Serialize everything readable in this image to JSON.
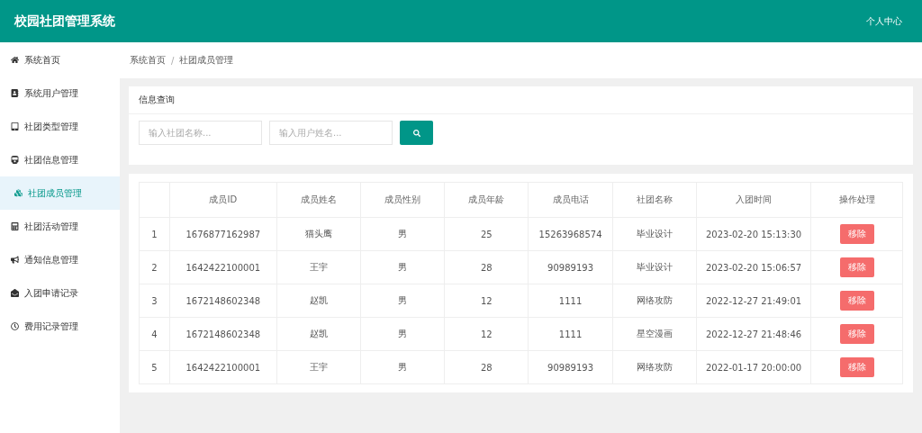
{
  "header": {
    "title": "校园社团管理系统",
    "user_link": "个人中心"
  },
  "sidebar": {
    "items": [
      {
        "label": "系统首页",
        "selected": false
      },
      {
        "label": "系统用户管理",
        "selected": false
      },
      {
        "label": "社团类型管理",
        "selected": false
      },
      {
        "label": "社团信息管理",
        "selected": false
      },
      {
        "label": "社团成员管理",
        "selected": true
      },
      {
        "label": "社团活动管理",
        "selected": false
      },
      {
        "label": "通知信息管理",
        "selected": false
      },
      {
        "label": "入团申请记录",
        "selected": false
      },
      {
        "label": "费用记录管理",
        "selected": false
      }
    ]
  },
  "breadcrumb": [
    "系统首页",
    "社团成员管理"
  ],
  "breadcrumb_separator": "/",
  "search": {
    "title": "信息查询",
    "fields": [
      {
        "placeholder": "输入社团名称..."
      },
      {
        "placeholder": "输入用户姓名..."
      }
    ]
  },
  "table": {
    "columns": [
      "",
      "成员ID",
      "成员姓名",
      "成员性别",
      "成员年龄",
      "成员电话",
      "社团名称",
      "入团时间",
      "操作处理"
    ],
    "rows": [
      {
        "cells": [
          "1",
          "1676877162987",
          "猫头鹰",
          "男",
          "25",
          "15263968574",
          "毕业设计",
          "2023-02-20 15:13:30"
        ],
        "action": "移除"
      },
      {
        "cells": [
          "2",
          "1642422100001",
          "王宇",
          "男",
          "28",
          "90989193",
          "毕业设计",
          "2023-02-20 15:06:57"
        ],
        "action": "移除"
      },
      {
        "cells": [
          "3",
          "1672148602348",
          "赵凯",
          "男",
          "12",
          "1111",
          "网络攻防",
          "2022-12-27 21:49:01"
        ],
        "action": "移除"
      },
      {
        "cells": [
          "4",
          "1672148602348",
          "赵凯",
          "男",
          "12",
          "1111",
          "星空漫画",
          "2022-12-27 21:48:46"
        ],
        "action": "移除"
      },
      {
        "cells": [
          "5",
          "1642422100001",
          "王宇",
          "男",
          "28",
          "90989193",
          "网络攻防",
          "2022-01-17 20:00:00"
        ],
        "action": "移除"
      }
    ]
  }
}
